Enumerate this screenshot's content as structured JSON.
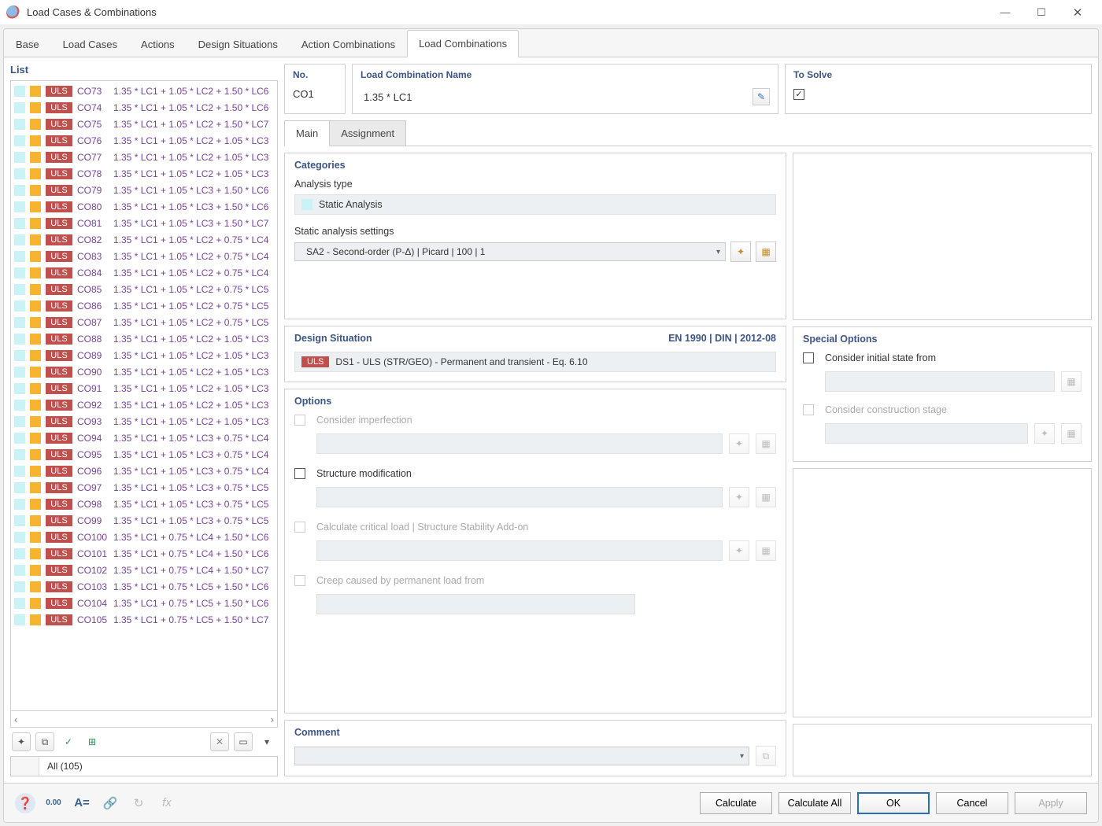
{
  "window": {
    "title": "Load Cases & Combinations"
  },
  "toptabs": [
    "Base",
    "Load Cases",
    "Actions",
    "Design Situations",
    "Action Combinations",
    "Load Combinations"
  ],
  "toptab_active": 5,
  "list": {
    "title": "List",
    "pill": "ULS",
    "filter": "All (105)",
    "rows": [
      {
        "co": "CO73",
        "desc": "1.35 * LC1 + 1.05 * LC2 + 1.50 * LC6"
      },
      {
        "co": "CO74",
        "desc": "1.35 * LC1 + 1.05 * LC2 + 1.50 * LC6"
      },
      {
        "co": "CO75",
        "desc": "1.35 * LC1 + 1.05 * LC2 + 1.50 * LC7"
      },
      {
        "co": "CO76",
        "desc": "1.35 * LC1 + 1.05 * LC2 + 1.05 * LC3"
      },
      {
        "co": "CO77",
        "desc": "1.35 * LC1 + 1.05 * LC2 + 1.05 * LC3"
      },
      {
        "co": "CO78",
        "desc": "1.35 * LC1 + 1.05 * LC2 + 1.05 * LC3"
      },
      {
        "co": "CO79",
        "desc": "1.35 * LC1 + 1.05 * LC3 + 1.50 * LC6"
      },
      {
        "co": "CO80",
        "desc": "1.35 * LC1 + 1.05 * LC3 + 1.50 * LC6"
      },
      {
        "co": "CO81",
        "desc": "1.35 * LC1 + 1.05 * LC3 + 1.50 * LC7"
      },
      {
        "co": "CO82",
        "desc": "1.35 * LC1 + 1.05 * LC2 + 0.75 * LC4"
      },
      {
        "co": "CO83",
        "desc": "1.35 * LC1 + 1.05 * LC2 + 0.75 * LC4"
      },
      {
        "co": "CO84",
        "desc": "1.35 * LC1 + 1.05 * LC2 + 0.75 * LC4"
      },
      {
        "co": "CO85",
        "desc": "1.35 * LC1 + 1.05 * LC2 + 0.75 * LC5"
      },
      {
        "co": "CO86",
        "desc": "1.35 * LC1 + 1.05 * LC2 + 0.75 * LC5"
      },
      {
        "co": "CO87",
        "desc": "1.35 * LC1 + 1.05 * LC2 + 0.75 * LC5"
      },
      {
        "co": "CO88",
        "desc": "1.35 * LC1 + 1.05 * LC2 + 1.05 * LC3"
      },
      {
        "co": "CO89",
        "desc": "1.35 * LC1 + 1.05 * LC2 + 1.05 * LC3"
      },
      {
        "co": "CO90",
        "desc": "1.35 * LC1 + 1.05 * LC2 + 1.05 * LC3"
      },
      {
        "co": "CO91",
        "desc": "1.35 * LC1 + 1.05 * LC2 + 1.05 * LC3"
      },
      {
        "co": "CO92",
        "desc": "1.35 * LC1 + 1.05 * LC2 + 1.05 * LC3"
      },
      {
        "co": "CO93",
        "desc": "1.35 * LC1 + 1.05 * LC2 + 1.05 * LC3"
      },
      {
        "co": "CO94",
        "desc": "1.35 * LC1 + 1.05 * LC3 + 0.75 * LC4"
      },
      {
        "co": "CO95",
        "desc": "1.35 * LC1 + 1.05 * LC3 + 0.75 * LC4"
      },
      {
        "co": "CO96",
        "desc": "1.35 * LC1 + 1.05 * LC3 + 0.75 * LC4"
      },
      {
        "co": "CO97",
        "desc": "1.35 * LC1 + 1.05 * LC3 + 0.75 * LC5"
      },
      {
        "co": "CO98",
        "desc": "1.35 * LC1 + 1.05 * LC3 + 0.75 * LC5"
      },
      {
        "co": "CO99",
        "desc": "1.35 * LC1 + 1.05 * LC3 + 0.75 * LC5"
      },
      {
        "co": "CO100",
        "desc": "1.35 * LC1 + 0.75 * LC4 + 1.50 * LC6"
      },
      {
        "co": "CO101",
        "desc": "1.35 * LC1 + 0.75 * LC4 + 1.50 * LC6"
      },
      {
        "co": "CO102",
        "desc": "1.35 * LC1 + 0.75 * LC4 + 1.50 * LC7"
      },
      {
        "co": "CO103",
        "desc": "1.35 * LC1 + 0.75 * LC5 + 1.50 * LC6"
      },
      {
        "co": "CO104",
        "desc": "1.35 * LC1 + 0.75 * LC5 + 1.50 * LC6"
      },
      {
        "co": "CO105",
        "desc": "1.35 * LC1 + 0.75 * LC5 + 1.50 * LC7"
      }
    ]
  },
  "header": {
    "no_label": "No.",
    "no_value": "CO1",
    "name_label": "Load Combination Name",
    "name_value": "1.35 * LC1",
    "solve_label": "To Solve",
    "solve_checked": true
  },
  "subtabs": [
    "Main",
    "Assignment"
  ],
  "subtab_active": 0,
  "categories": {
    "title": "Categories",
    "analysis_type_label": "Analysis type",
    "analysis_type_value": "Static Analysis",
    "settings_label": "Static analysis settings",
    "settings_value": "SA2 - Second-order (P-Δ) | Picard | 100 | 1"
  },
  "design": {
    "title": "Design Situation",
    "code": "EN 1990 | DIN | 2012-08",
    "pill": "ULS",
    "text": "DS1 - ULS (STR/GEO) - Permanent and transient - Eq. 6.10"
  },
  "options": {
    "title": "Options",
    "consider_imperfection": "Consider imperfection",
    "structure_modification": "Structure modification",
    "critical_load": "Calculate critical load | Structure Stability Add-on",
    "creep": "Creep caused by permanent load from"
  },
  "special": {
    "title": "Special Options",
    "initial_state": "Consider initial state from",
    "construction_stage": "Consider construction stage"
  },
  "comment": {
    "title": "Comment"
  },
  "footer": {
    "calculate": "Calculate",
    "calculate_all": "Calculate All",
    "ok": "OK",
    "cancel": "Cancel",
    "apply": "Apply"
  },
  "icons": {
    "new": "✦",
    "copy": "⧉",
    "check": "✓",
    "tree": "⊞",
    "delete": "✕",
    "pair": "▭",
    "help": "❓",
    "num": "0.00",
    "eq": "A=",
    "link": "🔗",
    "redo": "↻",
    "fx": "fx",
    "edit": "✎"
  }
}
